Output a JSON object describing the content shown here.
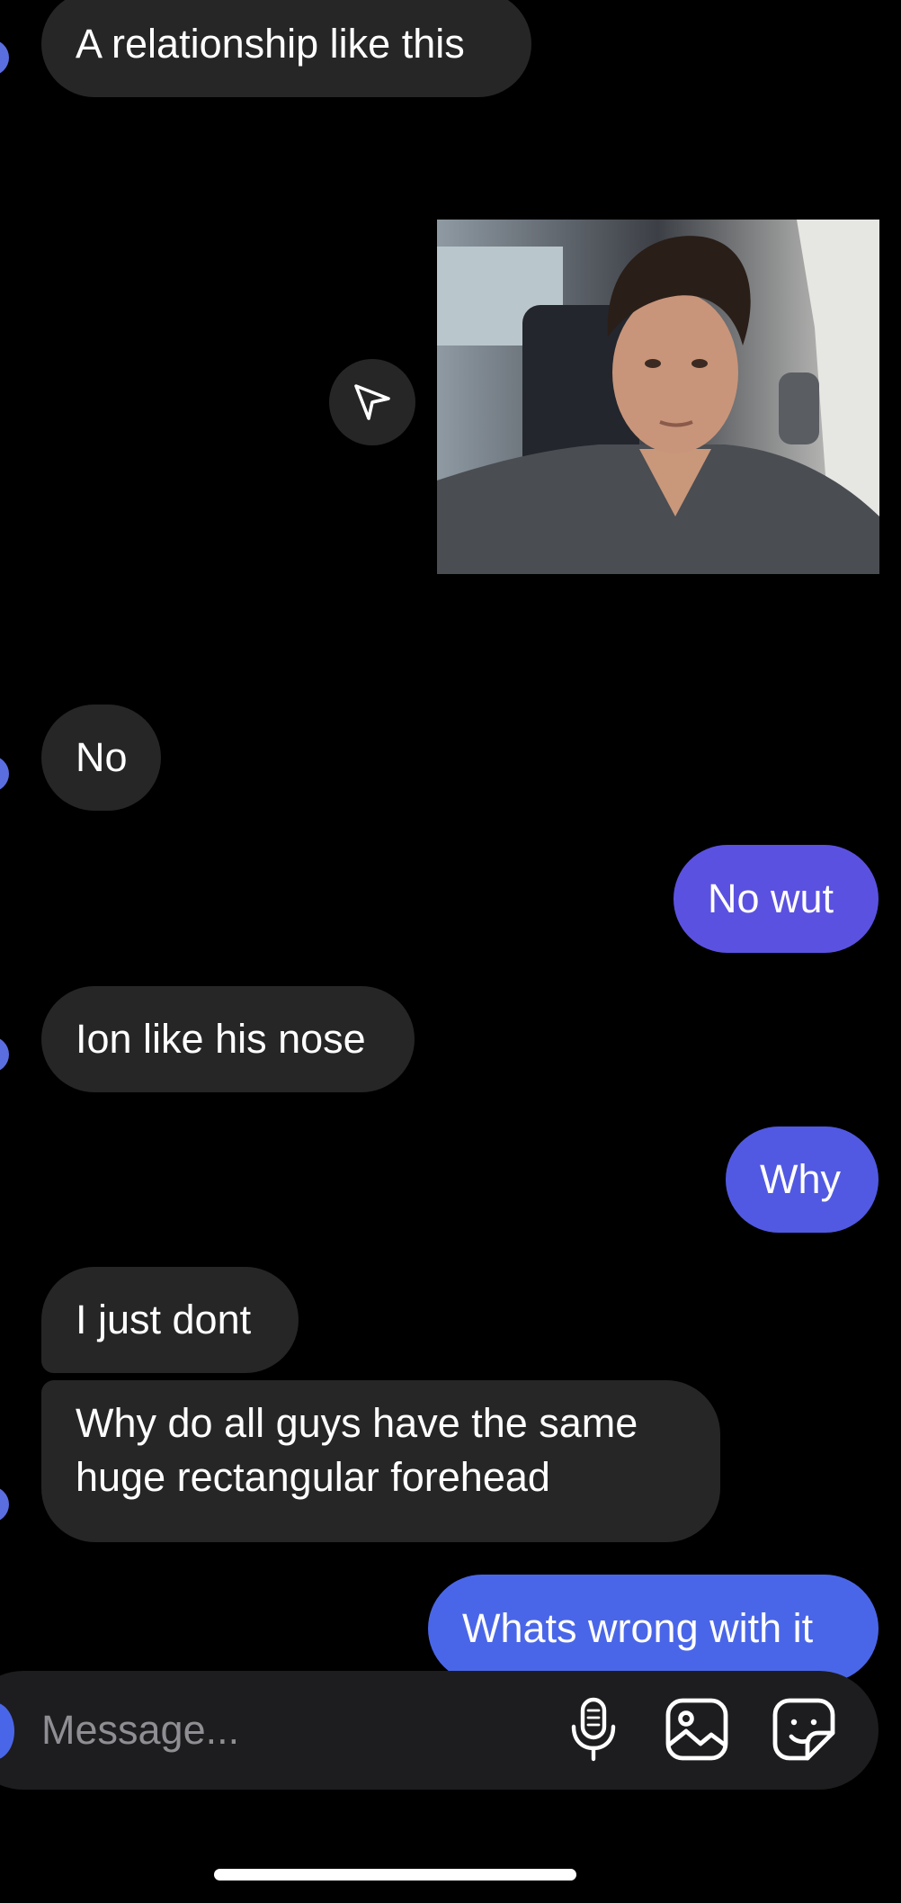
{
  "messages": [
    {
      "direction": "incoming",
      "text": "A relationship like this"
    },
    {
      "direction": "outgoing",
      "type": "image",
      "image": "selfie-photo"
    },
    {
      "direction": "incoming",
      "text": "No"
    },
    {
      "direction": "outgoing",
      "text": "No wut",
      "color": "#5b51e0"
    },
    {
      "direction": "incoming",
      "text": "Ion like his nose"
    },
    {
      "direction": "outgoing",
      "text": "Why",
      "color": "#5159e2"
    },
    {
      "direction": "incoming",
      "text": "I just dont"
    },
    {
      "direction": "incoming",
      "text": "Why do all guys have the same huge rectangular forehead"
    },
    {
      "direction": "outgoing",
      "text": "Whats wrong with it",
      "color": "#4a66e8"
    }
  ],
  "composer": {
    "placeholder": "Message..."
  },
  "icons": {
    "share": "send-icon",
    "mic": "microphone-icon",
    "gallery": "image-icon",
    "sticker": "sticker-icon"
  },
  "colors": {
    "background": "#000000",
    "incoming_bubble": "#262626",
    "composer": "#1d1d1f"
  }
}
